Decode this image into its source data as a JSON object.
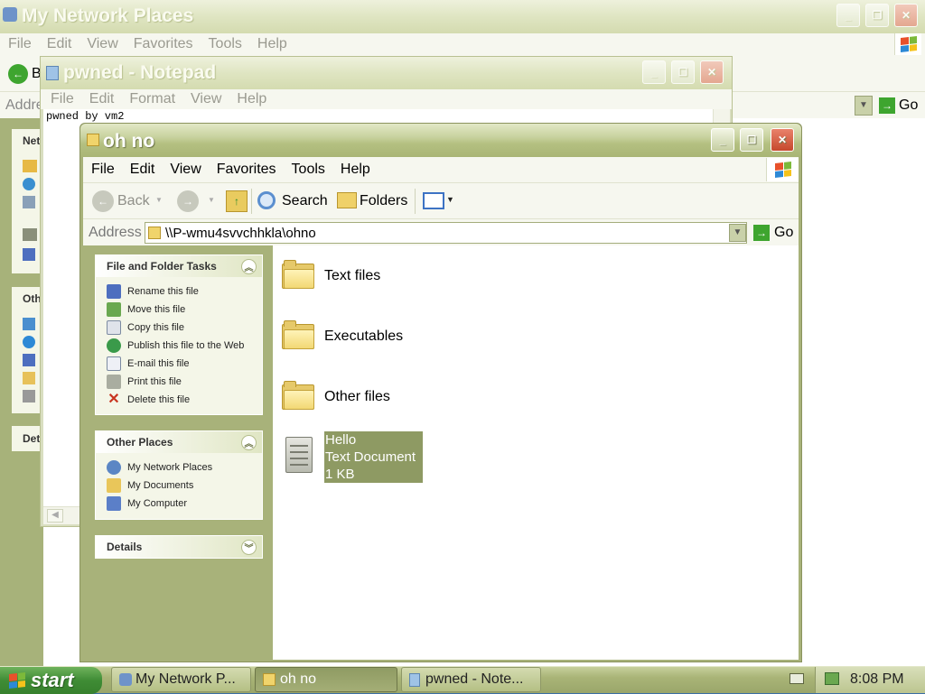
{
  "bg_window": {
    "title": "My Network Places",
    "menu": [
      "File",
      "Edit",
      "View",
      "Favorites",
      "Tools",
      "Help"
    ],
    "back_label": "B",
    "address_label": "Addre",
    "go_label": "Go",
    "side_heads": [
      "Net",
      "Oth",
      "Det"
    ]
  },
  "notepad": {
    "title": "pwned - Notepad",
    "menu": [
      "File",
      "Edit",
      "Format",
      "View",
      "Help"
    ],
    "content": "pwned by vm2"
  },
  "explorer": {
    "title": "oh no",
    "menu": [
      "File",
      "Edit",
      "View",
      "Favorites",
      "Tools",
      "Help"
    ],
    "toolbar": {
      "back": "Back",
      "search": "Search",
      "folders": "Folders"
    },
    "address_label": "Address",
    "address_value": "\\\\P-wmu4svvchhkla\\ohno",
    "go_label": "Go",
    "tasks": {
      "title": "File and Folder Tasks",
      "items": [
        "Rename this file",
        "Move this file",
        "Copy this file",
        "Publish this file to the Web",
        "E-mail this file",
        "Print this file",
        "Delete this file"
      ]
    },
    "other_places": {
      "title": "Other Places",
      "items": [
        "My Network Places",
        "My Documents",
        "My Computer"
      ]
    },
    "details": {
      "title": "Details"
    },
    "files": [
      {
        "name": "Text files"
      },
      {
        "name": "Executables"
      },
      {
        "name": "Other files"
      }
    ],
    "selected_file": {
      "name": "Hello",
      "type": "Text Document",
      "size": "1 KB"
    }
  },
  "taskbar": {
    "start": "start",
    "buttons": [
      "My Network P...",
      "oh no",
      "pwned - Note..."
    ],
    "clock": "8:08 PM"
  }
}
